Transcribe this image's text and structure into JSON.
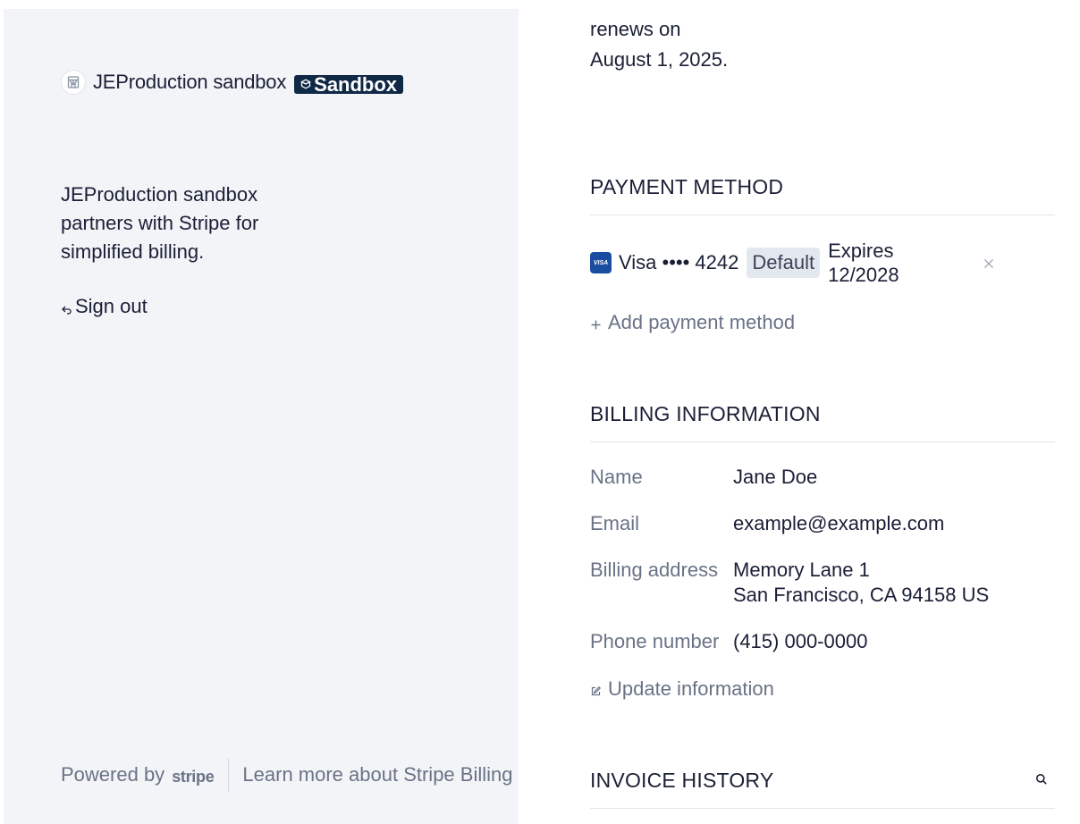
{
  "brand": {
    "logo_icon": "storefront-icon",
    "name": "JEProduction sandbox",
    "badge": "Sandbox",
    "badge_icon": "sandbox-cube-icon"
  },
  "tagline": "JEProduction sandbox partners with Stripe for simplified billing.",
  "signout": {
    "icon": "sign-out-arrow-icon",
    "label": "Sign out"
  },
  "footer": {
    "powered_by": "Powered by",
    "stripe": "stripe",
    "learn_more": "Learn more about Stripe Billing"
  },
  "subscription": {
    "renews_line": "renews on",
    "renews_date": "August 1, 2025."
  },
  "payment_method": {
    "title": "PAYMENT METHOD",
    "card": {
      "brand_icon": "visa-icon",
      "brand_mark": "VISA",
      "label": "Visa •••• 4242",
      "badge": "Default",
      "expires_label": "Expires",
      "expires_date": "12/2028",
      "remove_icon": "close-icon"
    },
    "add_label": "Add payment method",
    "add_icon": "plus-icon"
  },
  "billing": {
    "title": "BILLING INFORMATION",
    "rows": [
      {
        "label": "Name",
        "value": "Jane Doe"
      },
      {
        "label": "Email",
        "value": "example@example.com"
      },
      {
        "label": "Billing address",
        "value": "Memory Lane 1",
        "value2": "San Francisco, CA 94158 US"
      },
      {
        "label": "Phone number",
        "value": "(415) 000-0000"
      }
    ],
    "update_label": "Update information",
    "update_icon": "edit-icon"
  },
  "invoice_history": {
    "title": "INVOICE HISTORY",
    "search_icon": "search-icon"
  },
  "colors": {
    "left_bg": "#f3f4f8",
    "text": "#1a1f36",
    "muted": "#697386",
    "badge_dark": "#0f2846",
    "visa_blue": "#1a4da0"
  }
}
